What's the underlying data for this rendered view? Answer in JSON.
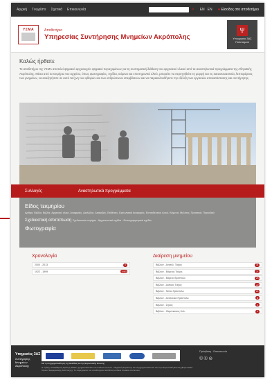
{
  "nav": {
    "home": "Αρχική",
    "about": "Γνωρίστε",
    "manual": "Σχετικά",
    "contact": "Επικοινωνία",
    "lang_en": "EN",
    "lang_el": "EN",
    "login": "Είσοδος στο αποθετήριο"
  },
  "header": {
    "logo_text": "ΥΣΜΑ",
    "subtitle": "Αποθετήριο",
    "title": "Υπηρεσίας Συντήρησης Μνημείων Ακρόπολης",
    "ministry": "Υπουργείο 3ΑΣ Πολιτισμού"
  },
  "welcome": {
    "heading": "Καλώς ήρθατε",
    "body": "Το αποθετήριο της ΥΣΜΑ αποτελεί ψηφιακό αρχειουχείο ψηφιακό περιεχομένων για τη συστηματική διάθεση του αρχειακού υλικού από τα αναστηλωτικά προγράμματα της Αθηναϊκής Ακρόπολης. Μέσα από τα τεκμήρια του αρχείου, όπως φωτογραφίες, σχέδια, κείμενα και επιστημονικό υλικό, μπορείτε να περιηγηθείτε τη μορφή και τις κατασκευαστικές λεπτομέρειες των μνημείων, να αναζητήσετε σε αυτό τα ίχνη των φθορών και των ανθρώπινων επεμβάσεων και να παρακολουθήσετε την εξέλιξη των εργασιών αποκατάστασης και συντήρησης."
  },
  "redbar": {
    "left": "Συλλογές",
    "right": "Αναστηλωτικά προγράμματα"
  },
  "types": {
    "heading": "Είδος τεκμηρίου",
    "sub": "Αρθρα, Βιβλία, Βιβλία, Αρχειακό υλικό, Αναφορές, Διαλέξεις, Διατριβές, Εκθέσεις, Ερευνητικά Αναφορές, Εκπαιδευτικό υλικό, Κείμενα, Μελέτες, Πρακτικά, Περιοδικά",
    "drawings": "Σχεδιαστική αποτύπωση",
    "drawings_sub": "Σχεδιαστικά τεκμήρια · Αρχιτεκτονικά σχέδια · Φωτογραμμετρικά σχέδια",
    "photos": "Φωτογραφία"
  },
  "chronology": {
    "heading": "Χρονολογία",
    "rows": [
      {
        "label": "2000 - 2013",
        "count": "4"
      },
      {
        "label": "1922 - 1999",
        "count": "1080"
      }
    ]
  },
  "monuments": {
    "heading": "Διαίρεση μνημείου",
    "rows": [
      {
        "label": "Βιβλίον - Ανατολ. Τοίχος",
        "count": "31"
      },
      {
        "label": "Βιβλίον - Βόρειος Τοίχος",
        "count": "21"
      },
      {
        "label": "Βιβλίον - Βόρειο Πρόστυλο",
        "count": "24"
      },
      {
        "label": "Βιβλίον - Δυτικός Τοίχος",
        "count": "22"
      },
      {
        "label": "Βιβλίον - Νότιο Πρόστυλο",
        "count": "21"
      },
      {
        "label": "Βιβλίον - Ανατολικό Πρόστυλο",
        "count": "8"
      },
      {
        "label": "Βιβλίον - Σηκός",
        "count": "4"
      },
      {
        "label": "Βιβλίον - Θεμελιώσεις Κυλ.",
        "count": "4"
      }
    ]
  },
  "footer": {
    "logo_title": "Υπηρεσίες 3ΑΣ",
    "logo_sub": "Συντήρησης Μνημείων Ακρόπολης",
    "caption": "Με τη συγχρηματοδότηση της Ελλάδας και της Ευρωπαϊκής Ένωσης",
    "small": "Η πράξη «Αναβάθμιση Δράσης ΕΣΠΑ» χρηματοδοτείται στο πλαίσιο του Ε.Π. «Ψηφιακή Σύγκλιση» και συγχρηματοδοτείται από την Ευρωπαϊκή Ένωση (Ευρωπαϊκό Ταμείο Περιφερειακής Ανάπτυξης). Το περιεχόμενο του αποθετηρίου διατίθεται με άδεια Creative Commons.",
    "contact": "Πρόσβαση · Επικοινωνία",
    "cc": "©①⊜"
  },
  "colors": {
    "accent": "#b71c1c",
    "dark": "#323232",
    "gray": "#8e8e8c"
  }
}
